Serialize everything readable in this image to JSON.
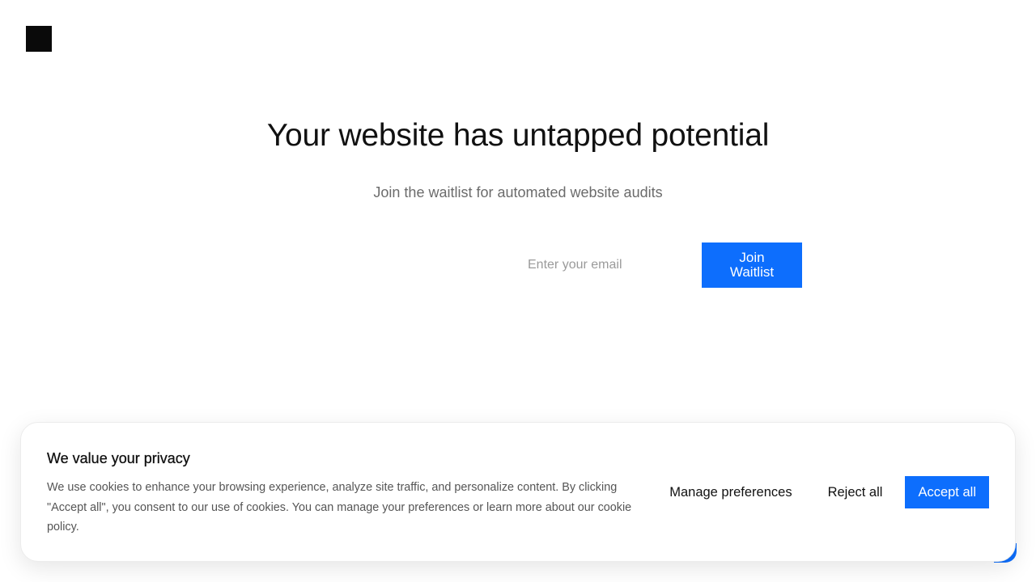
{
  "hero": {
    "headline": "Your website has untapped potential",
    "subheadline": "Join the waitlist for automated website audits"
  },
  "waitlist": {
    "email_placeholder": "Enter your email",
    "email_value": "",
    "button_label": "Join Waitlist"
  },
  "cookie_banner": {
    "title": "We value your privacy",
    "description": "We use cookies to enhance your browsing experience, analyze site traffic, and personalize content. By clicking \"Accept all\", you consent to our use of cookies. You can manage your preferences or learn more about our cookie policy.",
    "manage_label": "Manage preferences",
    "reject_label": "Reject all",
    "accept_label": "Accept all"
  },
  "colors": {
    "accent": "#0d6efd",
    "logo": "#0a0a0a",
    "background": "#ffffff"
  },
  "icons": {
    "logo": "brand-logo-square",
    "chat": "chat-widget-icon"
  }
}
